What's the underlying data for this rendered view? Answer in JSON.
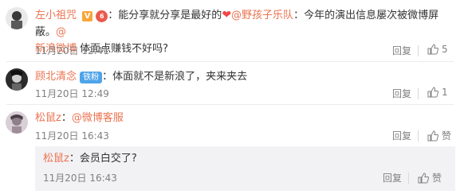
{
  "comments": [
    {
      "username": "左小祖咒",
      "text_before": "：能分享就分享是最好的",
      "mention1": "@野孩子乐队",
      "text_mid": "：今年的演出信息屡次被微博屏蔽。",
      "mention2_a": "@",
      "mention2_b": "新浪微博",
      "text_after": " 体面点赚钱不好吗?",
      "time": "11月20日 12:41",
      "reply_label": "回复",
      "like_count": "5"
    },
    {
      "username": "顾北清念",
      "badge": "铁粉",
      "text": "：体面就不是新浪了，夹来夹去",
      "time": "11月20日 12:49",
      "reply_label": "回复",
      "like_count": "1"
    },
    {
      "username": "松鼠z",
      "text_sep": "：",
      "mention": "@微博客服",
      "time": "11月20日 16:43",
      "reply_label": "回复",
      "like_label": "赞",
      "reply": {
        "username": "松鼠z",
        "text": "：会员白交了?",
        "time": "11月20日 16:43",
        "reply_label": "回复",
        "like_label": "赞"
      }
    }
  ],
  "colors": {
    "link": "#eb7350",
    "meta": "#808080",
    "nested_bg": "#f2f2f5"
  }
}
